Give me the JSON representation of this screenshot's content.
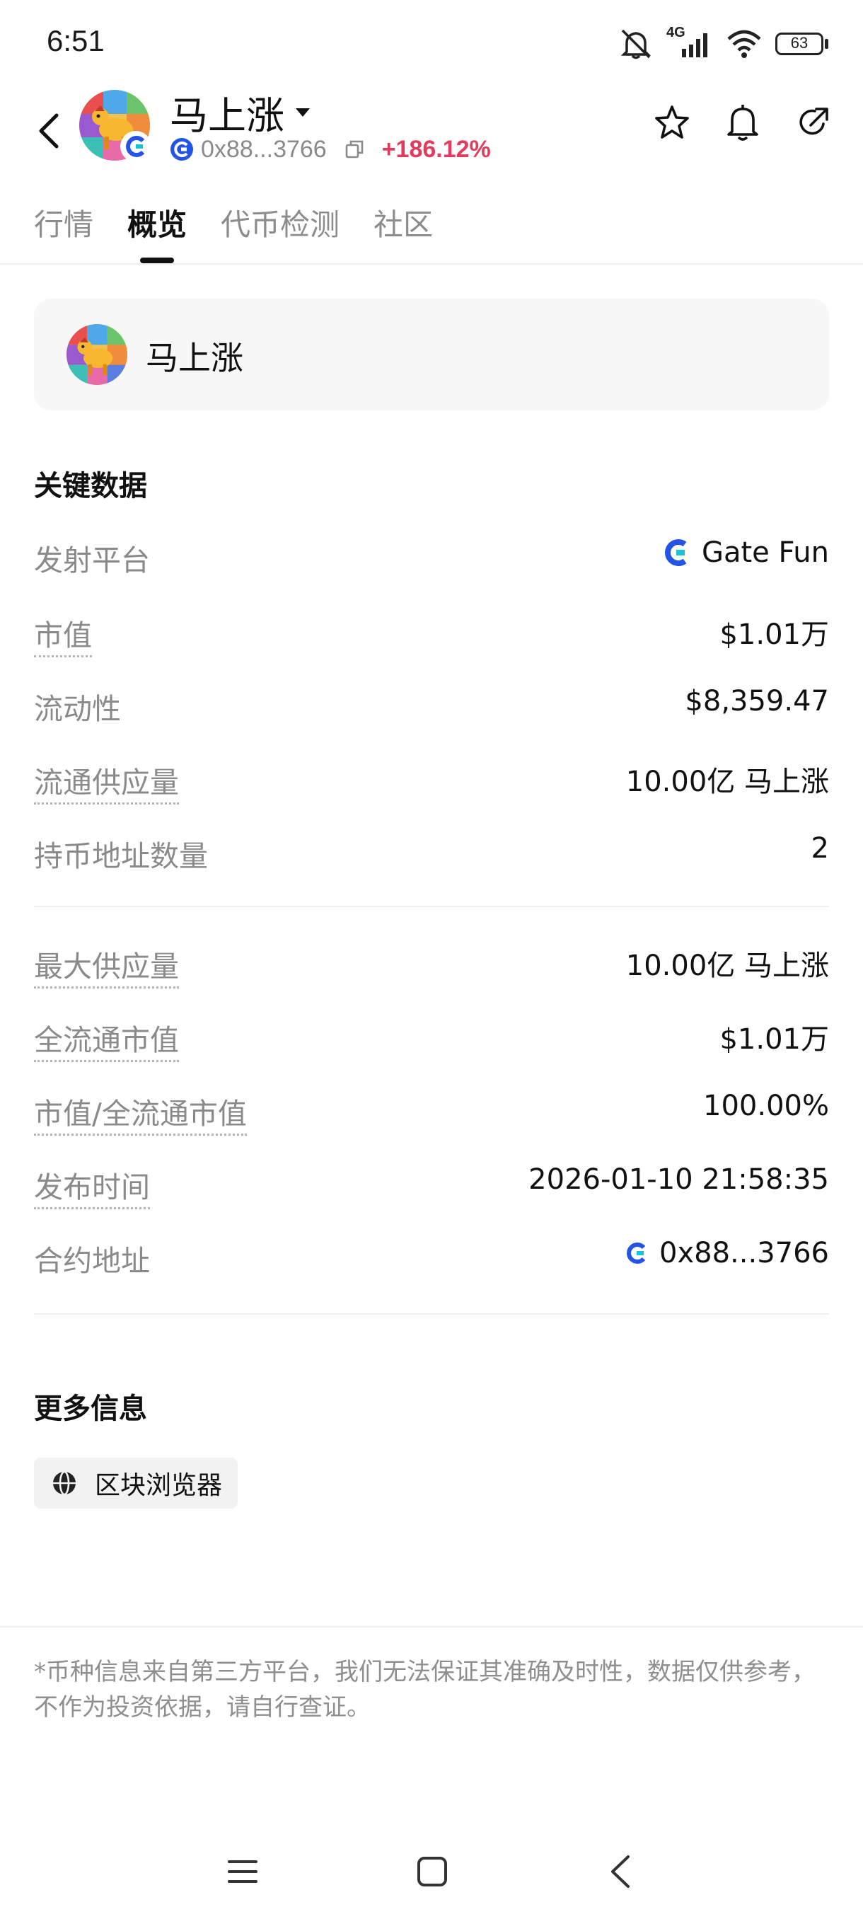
{
  "status_bar": {
    "time": "6:51",
    "network": "4G",
    "battery": "63"
  },
  "header": {
    "token_name": "马上涨",
    "address": "0x88...3766",
    "change": "+186.12%",
    "icons": [
      "back-arrow-icon",
      "dropdown-caret-icon",
      "copy-icon",
      "star-icon",
      "bell-icon",
      "share-icon"
    ]
  },
  "tabs": [
    {
      "label": "行情",
      "active": false
    },
    {
      "label": "概览",
      "active": true
    },
    {
      "label": "代币检测",
      "active": false
    },
    {
      "label": "社区",
      "active": false
    }
  ],
  "token_card": {
    "name": "马上涨"
  },
  "key_data": {
    "title": "关键数据",
    "rows": [
      {
        "label": "发射平台",
        "value": "Gate Fun"
      },
      {
        "label": "市值",
        "value": "$1.01万"
      },
      {
        "label": "流动性",
        "value": "$8,359.47"
      },
      {
        "label": "流通供应量",
        "value": "10.00亿 马上涨"
      },
      {
        "label": "持币地址数量",
        "value": "2"
      }
    ],
    "rows2": [
      {
        "label": "最大供应量",
        "value": "10.00亿 马上涨"
      },
      {
        "label": "全流通市值",
        "value": "$1.01万"
      },
      {
        "label": "市值/全流通市值",
        "value": "100.00%"
      },
      {
        "label": "发布时间",
        "value": "2026-01-10 21:58:35"
      },
      {
        "label": "合约地址",
        "value": "0x88...3766"
      }
    ]
  },
  "more_info": {
    "title": "更多信息",
    "explorer_label": "区块浏览器"
  },
  "disclaimer": "*币种信息来自第三方平台，我们无法保证其准确及时性，数据仅供参考，不作为投资依据，请自行查证。",
  "colors": {
    "accent_up": "#e23b5e",
    "gate_blue": "#2354e6",
    "gate_teal": "#17c3d6"
  }
}
